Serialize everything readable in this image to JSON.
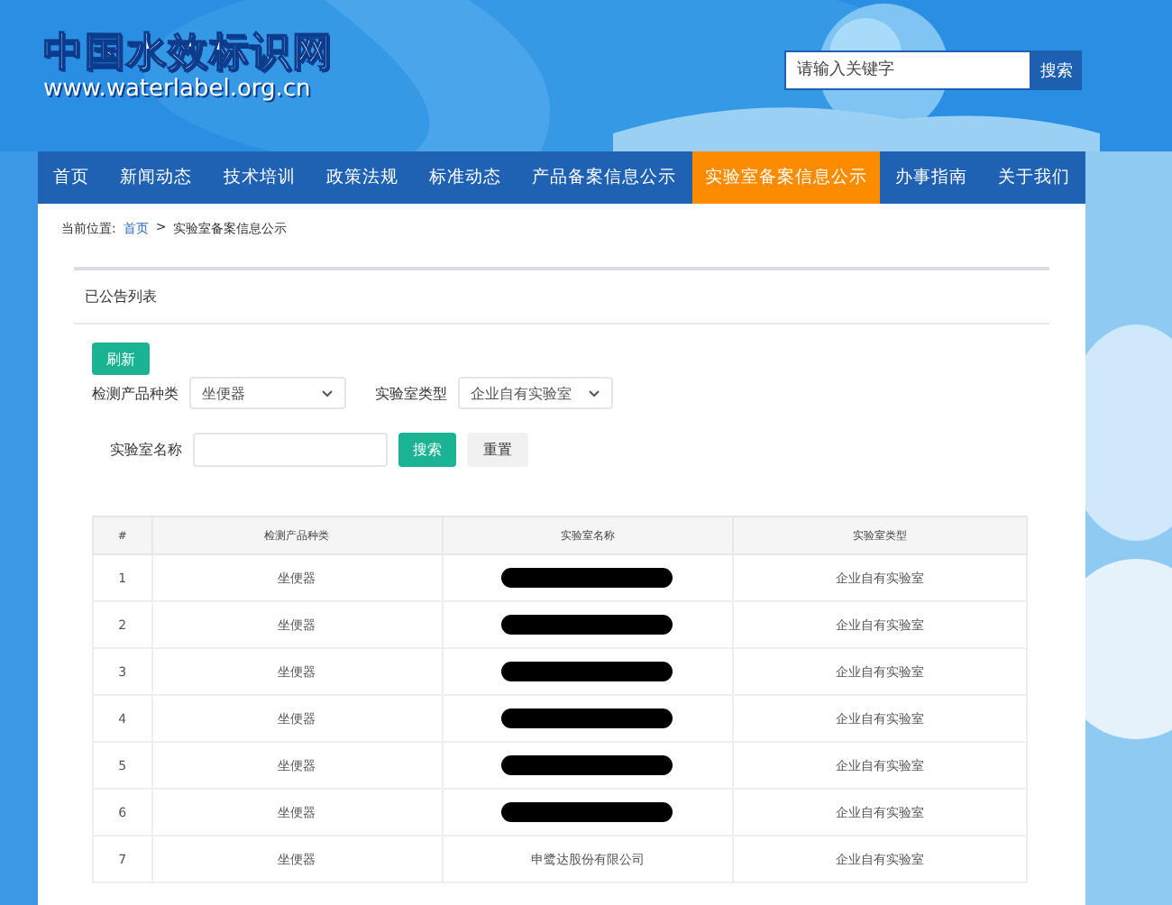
{
  "logo": {
    "title": "中国水效标识网",
    "url": "www.waterlabel.org.cn"
  },
  "search": {
    "placeholder": "请输入关键字",
    "button": "搜索"
  },
  "nav": [
    {
      "label": "首页",
      "selected": false
    },
    {
      "label": "新闻动态",
      "selected": false
    },
    {
      "label": "技术培训",
      "selected": false
    },
    {
      "label": "政策法规",
      "selected": false
    },
    {
      "label": "标准动态",
      "selected": false
    },
    {
      "label": "产品备案信息公示",
      "selected": false
    },
    {
      "label": "实验室备案信息公示",
      "selected": true
    },
    {
      "label": "办事指南",
      "selected": false
    },
    {
      "label": "关于我们",
      "selected": false
    }
  ],
  "breadcrumb": {
    "prefix": "当前位置:",
    "home": "首页",
    "separator": ">",
    "current": "实验室备案信息公示"
  },
  "panel_title": "已公告列表",
  "refresh_button": "刷新",
  "filters": [
    {
      "label": "检测产品种类",
      "value": "坐便器"
    },
    {
      "label": "实验室类型",
      "value": "企业自有实验室"
    }
  ],
  "name_filter": {
    "label": "实验室名称",
    "search_button": "搜索",
    "reset_button": "重置"
  },
  "table": {
    "columns": [
      "#",
      "检测产品种类",
      "实验室名称",
      "实验室类型"
    ],
    "rows": [
      {
        "index": "1",
        "product": "坐便器",
        "redacted": true,
        "type": "企业自有实验室"
      },
      {
        "index": "2",
        "product": "坐便器",
        "redacted": true,
        "type": "企业自有实验室"
      },
      {
        "index": "3",
        "product": "坐便器",
        "redacted": true,
        "type": "企业自有实验室"
      },
      {
        "index": "4",
        "product": "坐便器",
        "redacted": true,
        "type": "企业自有实验室"
      },
      {
        "index": "5",
        "product": "坐便器",
        "redacted": true,
        "type": "企业自有实验室"
      },
      {
        "index": "6",
        "product": "坐便器",
        "redacted": true,
        "type": "企业自有实验室"
      },
      {
        "index": "7",
        "product": "坐便器",
        "name": "申鹭达股份有限公司",
        "redacted": false,
        "type": "企业自有实验室"
      }
    ]
  }
}
